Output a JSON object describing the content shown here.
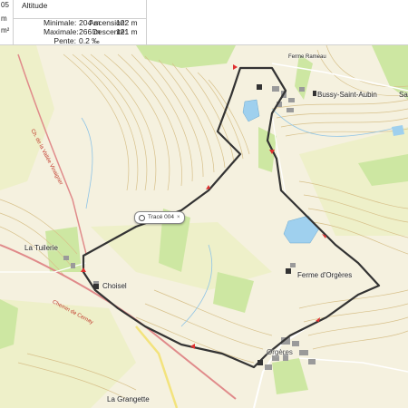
{
  "panel": {
    "left_values": [
      "05",
      "m",
      "m²"
    ],
    "altitude": {
      "title": "Altitude",
      "min_label": "Minimale:",
      "min_value": "204 m",
      "max_label": "Maximale:",
      "max_value": "266 m",
      "slope_label": "Pente:",
      "slope_value": "0.2 ‰",
      "ascent_label": "Ascension:",
      "ascent_value": "122 m",
      "descent_label": "Descente:",
      "descent_value": "121 m"
    }
  },
  "map": {
    "places": {
      "bussy": "Bussy-Saint-Aubin",
      "bussy_short": "Sa",
      "la_tuilerie": "La Tuilerie",
      "choisel": "Choisel",
      "ferme_orgeres": "Ferme d'Orgères",
      "orgeres": "Orgères",
      "la_grange": "La Grangette",
      "ferme_top": "Ferme Rameau"
    },
    "roads": {
      "road_west": "Ch. de la Vallée Vinaigrier",
      "road_south": "Chemin de Cernay"
    },
    "track_label": "Tracé 004",
    "track_close_icon": "close-icon",
    "track_icon": "track-icon",
    "colors": {
      "background": "#f5f1df",
      "forest": "#cde7a2",
      "field": "#eef0c9",
      "contour": "#d7c08a",
      "track": "#333333",
      "arrow": "#e03030",
      "water": "#9fd0ee",
      "road_red": "#e08a8a",
      "road_yellow": "#f3e37c"
    }
  }
}
